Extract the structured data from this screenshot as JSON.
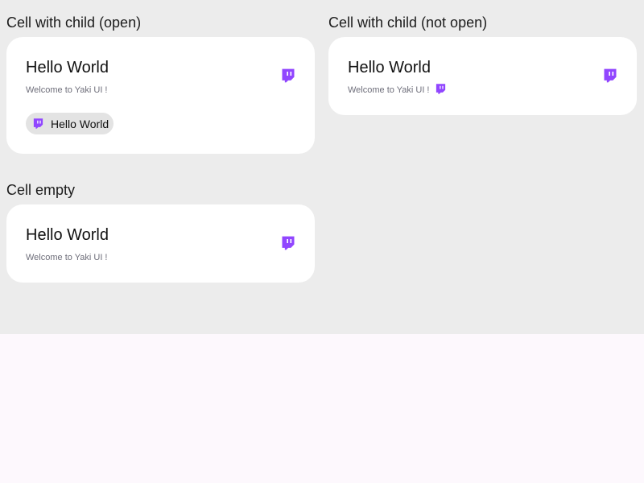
{
  "colors": {
    "accent": "#9146ff"
  },
  "sections": {
    "open": {
      "label": "Cell with child (open)",
      "title": "Hello World",
      "subtitle": "Welcome to Yaki UI !",
      "icon": "twitch-icon",
      "chip": {
        "label": "Hello World",
        "icon": "twitch-icon"
      }
    },
    "not_open": {
      "label": "Cell with child (not open)",
      "title": "Hello World",
      "subtitle": "Welcome to Yaki UI !",
      "icon": "twitch-icon",
      "inline_icon": "twitch-icon"
    },
    "empty": {
      "label": "Cell empty",
      "title": "Hello World",
      "subtitle": "Welcome to Yaki UI !",
      "icon": "twitch-icon"
    }
  }
}
